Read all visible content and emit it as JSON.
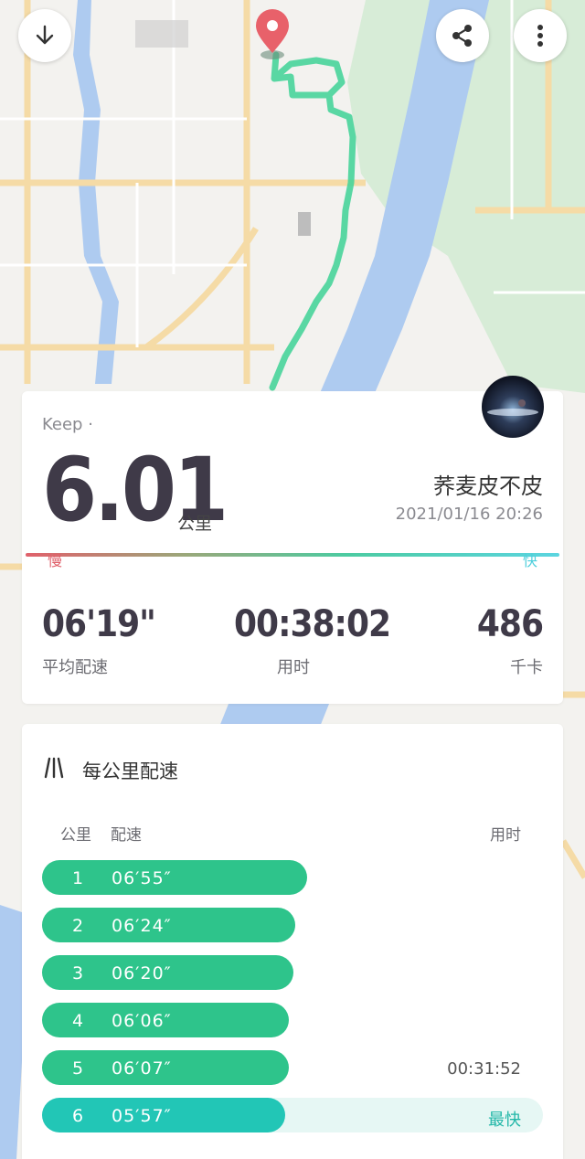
{
  "header": {
    "download_icon": "download-icon",
    "share_icon": "share-icon",
    "more_icon": "more-vertical-icon"
  },
  "map": {
    "route_color": "#48d49a",
    "pin_color": "#e8616a",
    "river_color": "#a9c8f2",
    "park_color": "#d5ecd6",
    "road_color": "#f7dca4"
  },
  "summary": {
    "app_label": "Keep · ",
    "distance": "6.01",
    "distance_unit": "公里",
    "username": "荞麦皮不皮",
    "datetime": "2021/01/16 20:26",
    "pace_bar_slow": "慢",
    "pace_bar_fast": "快",
    "stats": [
      {
        "value": "06'19\"",
        "label": "平均配速"
      },
      {
        "value": "00:38:02",
        "label": "用时"
      },
      {
        "value": "486",
        "label": "千卡"
      }
    ]
  },
  "splits": {
    "title": "每公里配速",
    "col_km": "公里",
    "col_pace": "配速",
    "col_time": "用时",
    "rows": [
      {
        "km": "1",
        "pace": "06′55″",
        "time": "",
        "fill": 1.0
      },
      {
        "km": "2",
        "pace": "06′24″",
        "time": "",
        "fill": 0.9
      },
      {
        "km": "3",
        "pace": "06′20″",
        "time": "",
        "fill": 0.89
      },
      {
        "km": "4",
        "pace": "06′06″",
        "time": "",
        "fill": 0.86
      },
      {
        "km": "5",
        "pace": "06′07″",
        "time": "00:31:52",
        "fill": 0.86
      },
      {
        "km": "6",
        "pace": "05′57″",
        "time": "",
        "fill": 0.84,
        "badge": "最快"
      }
    ],
    "accent": "#2ec48b",
    "fastest_accent": "#22c6b6"
  }
}
